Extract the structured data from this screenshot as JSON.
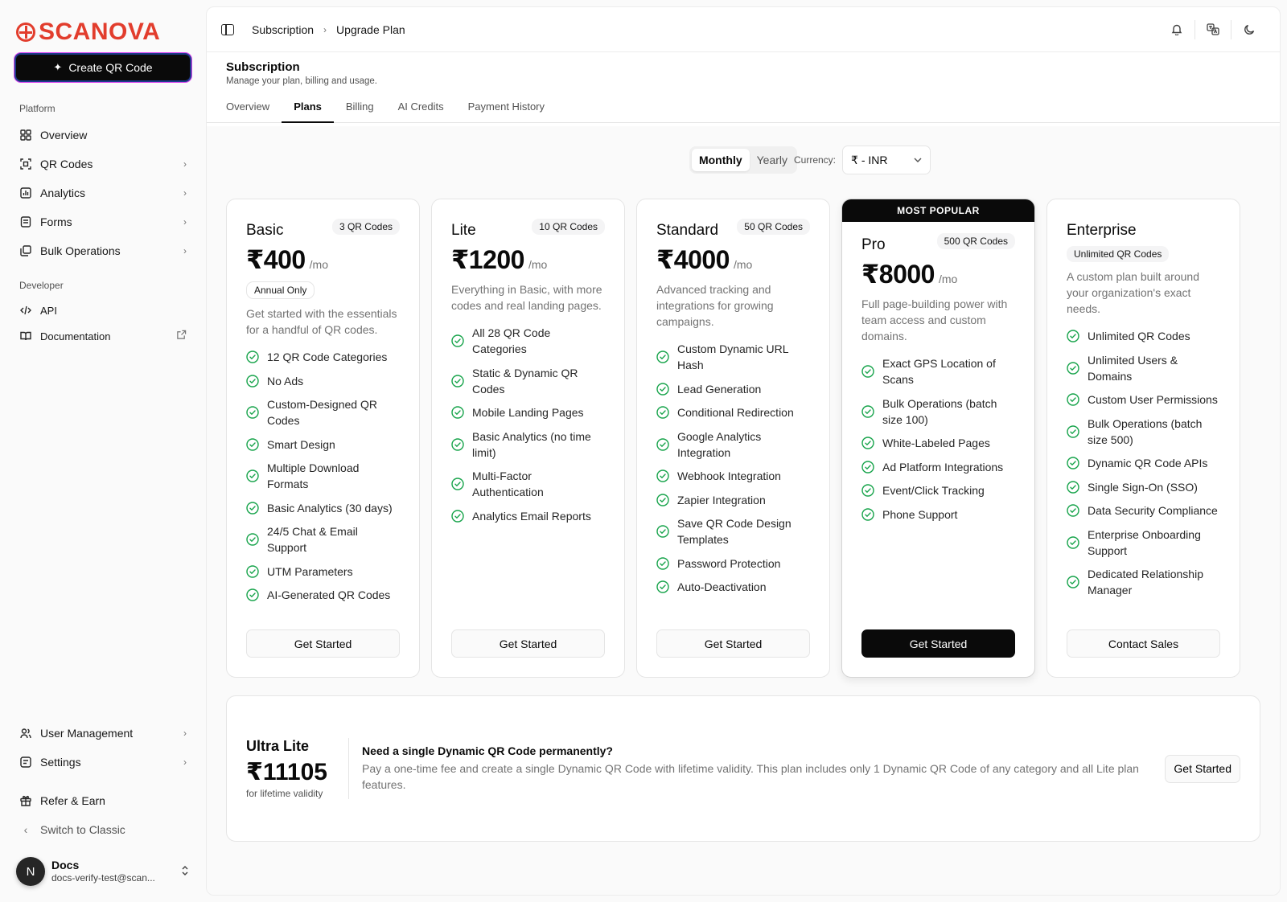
{
  "brand": {
    "name": "SCANOVA",
    "color": "#e23d2d"
  },
  "sidebar": {
    "create_button": "Create QR Code",
    "platform_heading": "Platform",
    "platform_items": [
      {
        "label": "Overview",
        "icon": "grid-icon"
      },
      {
        "label": "QR Codes",
        "icon": "qr-scan-icon"
      },
      {
        "label": "Analytics",
        "icon": "chart-icon"
      },
      {
        "label": "Forms",
        "icon": "form-icon"
      },
      {
        "label": "Bulk Operations",
        "icon": "stack-icon"
      }
    ],
    "developer_heading": "Developer",
    "developer_items": [
      {
        "label": "API",
        "icon": "code-icon"
      },
      {
        "label": "Documentation",
        "icon": "book-icon"
      }
    ],
    "bottom_items": [
      {
        "label": "User Management"
      },
      {
        "label": "Settings"
      },
      {
        "label": "Refer & Earn"
      },
      {
        "label": "Switch to Classic"
      }
    ],
    "user": {
      "initial": "N",
      "name": "Docs",
      "email": "docs-verify-test@scan..."
    }
  },
  "topbar": {
    "crumb_1": "Subscription",
    "crumb_2": "Upgrade Plan"
  },
  "header": {
    "title": "Subscription",
    "subtitle": "Manage your plan, billing and usage.",
    "tabs": [
      "Overview",
      "Plans",
      "Billing",
      "AI Credits",
      "Payment History"
    ],
    "active_tab": "Plans"
  },
  "controls": {
    "monthly": "Monthly",
    "yearly": "Yearly",
    "currency_label": "Currency:",
    "currency_value": "₹ - INR"
  },
  "plans": [
    {
      "name": "Basic",
      "badge": "3 QR Codes",
      "price": "₹400",
      "per": "/mo",
      "note": "Annual Only",
      "desc": "Get started with the essentials for a handful of QR codes.",
      "features": [
        "12 QR Code Categories",
        "No Ads",
        "Custom-Designed QR Codes",
        "Smart Design",
        "Multiple Download Formats",
        "Basic Analytics (30 days)",
        "24/5 Chat & Email Support",
        "UTM Parameters",
        "AI-Generated QR Codes"
      ],
      "cta": "Get Started"
    },
    {
      "name": "Lite",
      "badge": "10 QR Codes",
      "price": "₹1200",
      "per": "/mo",
      "desc": "Everything in Basic, with more codes and real landing pages.",
      "features": [
        "All 28 QR Code Categories",
        "Static & Dynamic QR Codes",
        "Mobile Landing Pages",
        "Basic Analytics (no time limit)",
        "Multi-Factor Authentication",
        "Analytics Email Reports"
      ],
      "cta": "Get Started"
    },
    {
      "name": "Standard",
      "badge": "50 QR Codes",
      "price": "₹4000",
      "per": "/mo",
      "desc": "Advanced tracking and integrations for growing campaigns.",
      "features": [
        "Custom Dynamic URL Hash",
        "Lead Generation",
        "Conditional Redirection",
        "Google Analytics Integration",
        "Webhook Integration",
        "Zapier Integration",
        "Save QR Code Design Templates",
        "Password Protection",
        "Auto-Deactivation"
      ],
      "cta": "Get Started"
    },
    {
      "name": "Pro",
      "badge": "500 QR Codes",
      "price": "₹8000",
      "per": "/mo",
      "banner": "MOST POPULAR",
      "desc": "Full page-building power with team access and custom domains.",
      "features": [
        "Exact GPS Location of Scans",
        "Bulk Operations (batch size 100)",
        "White-Labeled Pages",
        "Ad Platform Integrations",
        "Event/Click Tracking",
        "Phone Support"
      ],
      "cta": "Get Started"
    },
    {
      "name": "Enterprise",
      "badge": "Unlimited QR Codes",
      "desc": "A custom plan built around your organization's exact needs.",
      "features": [
        "Unlimited QR Codes",
        "Unlimited Users & Domains",
        "Custom User Permissions",
        "Bulk Operations (batch size 500)",
        "Dynamic QR Code APIs",
        "Single Sign-On (SSO)",
        "Data Security Compliance",
        "Enterprise Onboarding Support",
        "Dedicated Relationship Manager"
      ],
      "cta": "Contact Sales"
    }
  ],
  "ultra": {
    "name": "Ultra Lite",
    "price": "₹11105",
    "note": "for lifetime validity",
    "question": "Need a single Dynamic QR Code permanently?",
    "desc": "Pay a one-time fee and create a single Dynamic QR Code with lifetime validity. This plan includes only 1 Dynamic QR Code of any category and all Lite plan features.",
    "cta": "Get Started"
  },
  "colors": {
    "check": "#16a34a",
    "primary": "#0a0a0a"
  }
}
